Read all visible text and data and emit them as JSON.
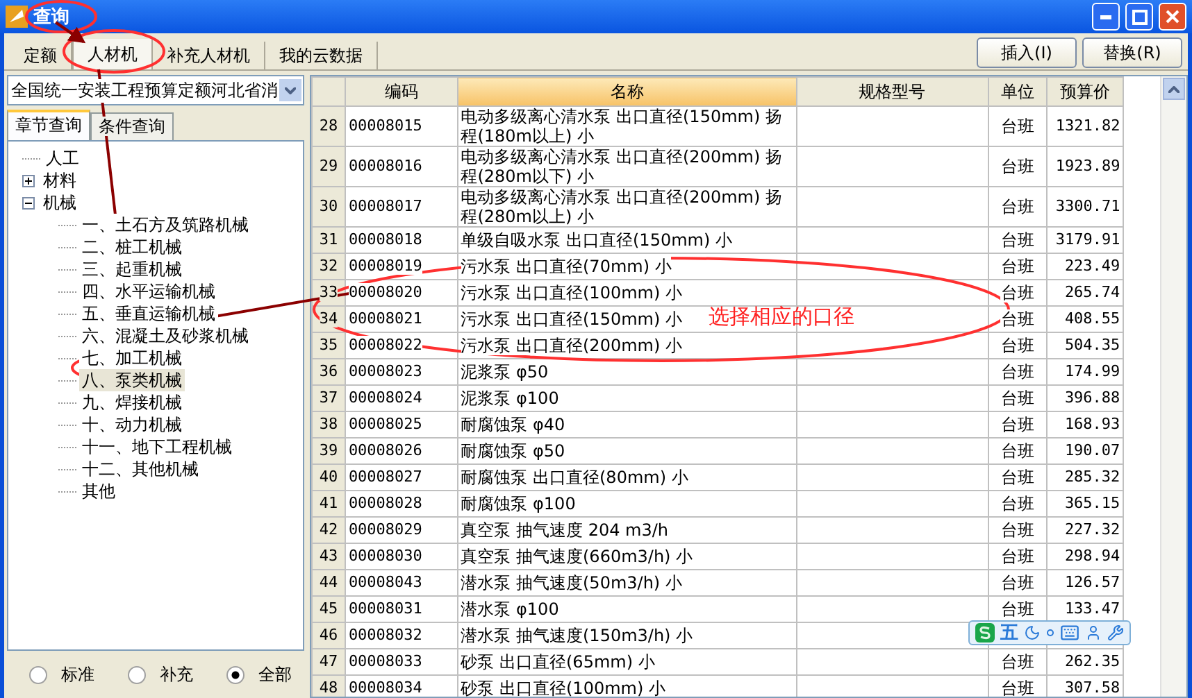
{
  "window": {
    "title": "查询"
  },
  "tabs": [
    {
      "label": "定额",
      "selected": false
    },
    {
      "label": "人材机",
      "selected": true
    },
    {
      "label": "补充人材机",
      "selected": false
    },
    {
      "label": "我的云数据",
      "selected": false
    }
  ],
  "actions": [
    "插入(I)",
    "替换(R)"
  ],
  "library": {
    "value": "全国统一安装工程预算定额河北省消"
  },
  "subtabs": [
    {
      "label": "章节查询",
      "selected": true
    },
    {
      "label": "条件查询",
      "selected": false
    }
  ],
  "tree": [
    {
      "label": "人工"
    },
    {
      "label": "材料",
      "expanded": false
    },
    {
      "label": "机械",
      "expanded": true,
      "children": [
        {
          "label": "一、土石方及筑路机械",
          "selected": false
        },
        {
          "label": "二、桩工机械",
          "selected": false
        },
        {
          "label": "三、起重机械",
          "selected": false
        },
        {
          "label": "四、水平运输机械",
          "selected": false
        },
        {
          "label": "五、垂直运输机械",
          "selected": false
        },
        {
          "label": "六、混凝土及砂浆机械",
          "selected": false
        },
        {
          "label": "七、加工机械",
          "selected": false
        },
        {
          "label": "八、泵类机械",
          "selected": true
        },
        {
          "label": "九、焊接机械",
          "selected": false
        },
        {
          "label": "十、动力机械",
          "selected": false
        },
        {
          "label": "十一、地下工程机械",
          "selected": false
        },
        {
          "label": "十二、其他机械",
          "selected": false
        },
        {
          "label": "其他",
          "selected": false
        }
      ]
    }
  ],
  "filters": [
    {
      "label": "标准",
      "selected": false
    },
    {
      "label": "补充",
      "selected": false
    },
    {
      "label": "全部",
      "selected": true
    }
  ],
  "table": {
    "columns": [
      "",
      "编码",
      "名称",
      "规格型号",
      "单位",
      "预算价"
    ],
    "rows": [
      [
        "28",
        "00008015",
        "电动多级离心清水泵 出口直径(150mm) 扬程(180m以上) 小",
        "",
        "台班",
        "1321.82"
      ],
      [
        "29",
        "00008016",
        "电动多级离心清水泵 出口直径(200mm) 扬程(280m以下) 小",
        "",
        "台班",
        "1923.89"
      ],
      [
        "30",
        "00008017",
        "电动多级离心清水泵 出口直径(200mm) 扬程(280m以上) 小",
        "",
        "台班",
        "3300.71"
      ],
      [
        "31",
        "00008018",
        "单级自吸水泵 出口直径(150mm) 小",
        "",
        "台班",
        "3179.91"
      ],
      [
        "32",
        "00008019",
        "污水泵 出口直径(70mm) 小",
        "",
        "台班",
        "223.49"
      ],
      [
        "33",
        "00008020",
        "污水泵 出口直径(100mm) 小",
        "",
        "台班",
        "265.74"
      ],
      [
        "34",
        "00008021",
        "污水泵 出口直径(150mm) 小",
        "",
        "台班",
        "408.55"
      ],
      [
        "35",
        "00008022",
        "污水泵 出口直径(200mm) 小",
        "",
        "台班",
        "504.35"
      ],
      [
        "36",
        "00008023",
        "泥浆泵 φ50",
        "",
        "台班",
        "174.99"
      ],
      [
        "37",
        "00008024",
        "泥浆泵 φ100",
        "",
        "台班",
        "396.88"
      ],
      [
        "38",
        "00008025",
        "耐腐蚀泵 φ40",
        "",
        "台班",
        "168.93"
      ],
      [
        "39",
        "00008026",
        "耐腐蚀泵 φ50",
        "",
        "台班",
        "190.07"
      ],
      [
        "40",
        "00008027",
        "耐腐蚀泵 出口直径(80mm) 小",
        "",
        "台班",
        "285.32"
      ],
      [
        "41",
        "00008028",
        "耐腐蚀泵 φ100",
        "",
        "台班",
        "365.15"
      ],
      [
        "42",
        "00008029",
        "真空泵 抽气速度 204 m3/h",
        "",
        "台班",
        "227.32"
      ],
      [
        "43",
        "00008030",
        "真空泵 抽气速度(660m3/h) 小",
        "",
        "台班",
        "298.94"
      ],
      [
        "44",
        "00008043",
        "潜水泵 抽气速度(50m3/h) 小",
        "",
        "台班",
        "126.57"
      ],
      [
        "45",
        "00008031",
        "潜水泵 φ100",
        "",
        "台班",
        "133.47"
      ],
      [
        "46",
        "00008032",
        "潜水泵 抽气速度(150m3/h) 小",
        "",
        "",
        ""
      ],
      [
        "47",
        "00008033",
        "砂泵 出口直径(65mm) 小",
        "",
        "台班",
        "262.35"
      ],
      [
        "48",
        "00008034",
        "砂泵 出口直径(100mm) 小",
        "",
        "台班",
        "307.58"
      ]
    ]
  },
  "annotation": {
    "note": "选择相应的口径"
  },
  "ime": {
    "mode": "五"
  }
}
